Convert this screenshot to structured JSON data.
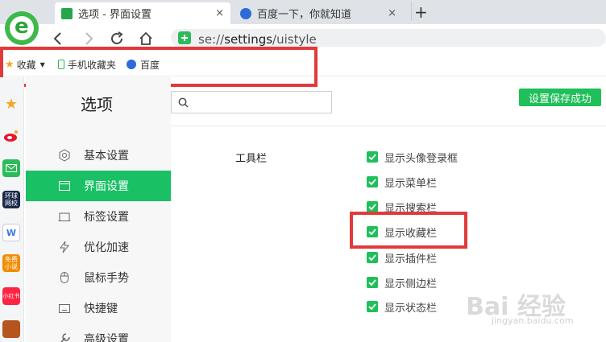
{
  "tabs": [
    {
      "label": "选项 - 界面设置",
      "close": "×",
      "icon": "gear-tab-icon",
      "color": "#25a64a"
    },
    {
      "label": "百度一下，你就知道",
      "close": "×",
      "icon": "baidu-paw-icon",
      "color": "#2f6bd8"
    }
  ],
  "new_tab": "+",
  "address": {
    "prefix": "se://",
    "page": "settings",
    "suffix": "/uistyle"
  },
  "bookmarks": {
    "favorites": "收藏",
    "mobile": "手机收藏夹",
    "baidu": "百度"
  },
  "sidebar_apps": [
    {
      "icon": "star-icon",
      "color": "#f5a623",
      "text": ""
    },
    {
      "icon": "weibo-icon",
      "color": "#e6162d",
      "text": ""
    },
    {
      "icon": "mail-icon",
      "color": "#2dbb5a",
      "text": ""
    },
    {
      "icon": "news-app-icon",
      "color": "#1b2a4a",
      "text": "环球\n网校"
    },
    {
      "icon": "word-doc-icon",
      "color": "#3b78e7",
      "text": "W"
    },
    {
      "icon": "novel-app-icon",
      "color": "#f28c00",
      "text": "免费\n小说"
    },
    {
      "icon": "xiaohongshu-icon",
      "color": "#ff2442",
      "text": "小红书"
    },
    {
      "icon": "game-app-icon",
      "color": "#b5541c",
      "text": ""
    }
  ],
  "page": {
    "title": "选项",
    "search_placeholder": "",
    "save_status": "设置保存成功",
    "accent": "#19c064"
  },
  "menu": [
    {
      "label": "基本设置",
      "icon": "hexagon-gear-icon"
    },
    {
      "label": "界面设置",
      "icon": "window-icon",
      "active": true
    },
    {
      "label": "标签设置",
      "icon": "tab-icon"
    },
    {
      "label": "优化加速",
      "icon": "lightning-icon"
    },
    {
      "label": "鼠标手势",
      "icon": "mouse-icon"
    },
    {
      "label": "快捷键",
      "icon": "keyboard-icon"
    },
    {
      "label": "高级设置",
      "icon": "wrench-icon"
    }
  ],
  "toolbar_section": {
    "label": "工具栏",
    "options": [
      {
        "label": "显示头像登录框",
        "checked": true
      },
      {
        "label": "显示菜单栏",
        "checked": true
      },
      {
        "label": "显示搜索栏",
        "checked": true
      },
      {
        "label": "显示收藏栏",
        "checked": true
      },
      {
        "label": "显示插件栏",
        "checked": true
      },
      {
        "label": "显示侧边栏",
        "checked": true
      },
      {
        "label": "显示状态栏",
        "checked": true
      }
    ]
  },
  "watermark": {
    "brand": "Bai 经验",
    "url": "jingyan.baidu.com"
  }
}
